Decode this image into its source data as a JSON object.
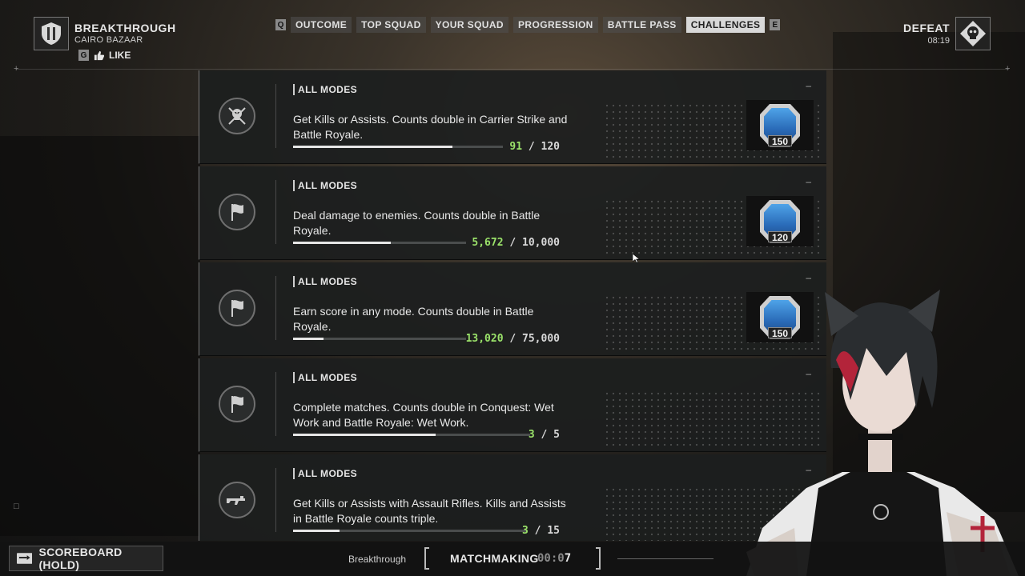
{
  "header": {
    "mode_title": "BREAKTHROUGH",
    "map_name": "CAIRO BAZAAR",
    "like_key": "G",
    "like_label": "LIKE",
    "tab_prev_key": "Q",
    "tab_next_key": "E",
    "tabs": [
      {
        "label": "OUTCOME",
        "active": false
      },
      {
        "label": "TOP SQUAD",
        "active": false
      },
      {
        "label": "YOUR SQUAD",
        "active": false
      },
      {
        "label": "PROGRESSION",
        "active": false
      },
      {
        "label": "BATTLE PASS",
        "active": false
      },
      {
        "label": "CHALLENGES",
        "active": true
      }
    ],
    "result": "DEFEAT",
    "match_time": "08:19"
  },
  "challenges": [
    {
      "mode": "ALL MODES",
      "icon": "skull-crossed-rifles-icon",
      "description": "Get Kills or Assists. Counts double in Carrier Strike and Battle Royale.",
      "current": "91",
      "total": "120",
      "progress": 0.758,
      "reward": "150",
      "has_reward": true
    },
    {
      "mode": "ALL MODES",
      "icon": "flag-icon",
      "description": "Deal damage to enemies. Counts double in Battle Royale.",
      "current": "5,672",
      "total": "10,000",
      "progress": 0.567,
      "reward": "120",
      "has_reward": true
    },
    {
      "mode": "ALL MODES",
      "icon": "flag-icon",
      "description": "Earn score in any mode. Counts double in Battle Royale.",
      "current": "13,020",
      "total": "75,000",
      "progress": 0.174,
      "reward": "150",
      "has_reward": true
    },
    {
      "mode": "ALL MODES",
      "icon": "flag-icon",
      "description": "Complete matches. Counts double in Conquest: Wet Work and Battle Royale: Wet Work.",
      "current": "3",
      "total": "5",
      "progress": 0.6,
      "has_reward": false
    },
    {
      "mode": "ALL MODES",
      "icon": "assault-rifle-icon",
      "description": "Get Kills or Assists with Assault Rifles. Kills and Assists in Battle Royale counts triple.",
      "current": "3",
      "total": "15",
      "progress": 0.2,
      "has_reward": false
    }
  ],
  "footer": {
    "scoreboard_label": "SCOREBOARD (HOLD)",
    "queue_mode": "Breakthrough",
    "matchmaking_label": "MATCHMAKING",
    "timer_dim": "00:0",
    "timer_bright": "7"
  },
  "colors": {
    "progress_current": "#9be36a",
    "active_tab": "#d8d8d8",
    "reward_blue": "#2a6bb8"
  }
}
